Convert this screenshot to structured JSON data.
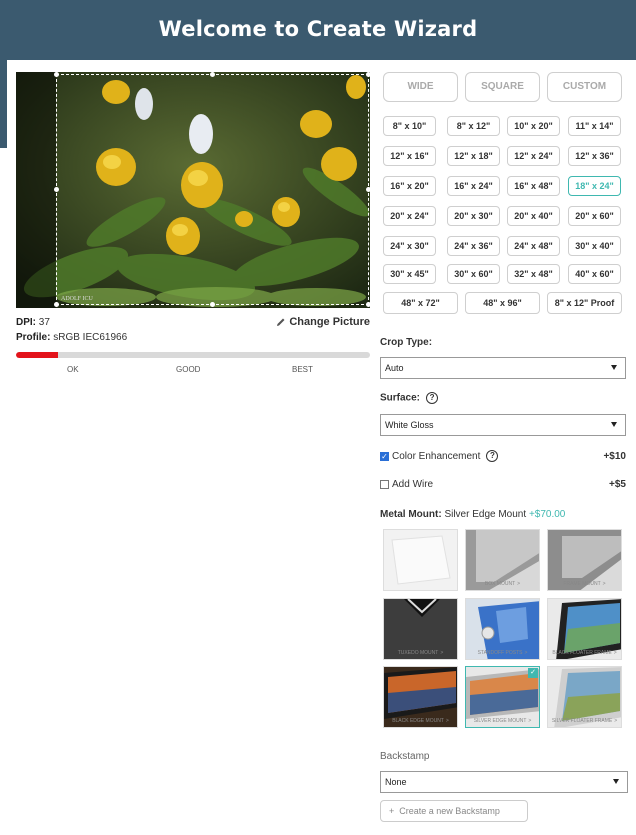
{
  "header": {
    "title": "Welcome to Create Wizard"
  },
  "image_panel": {
    "dpi_label": "DPI:",
    "dpi_value": "37",
    "profile_label": "Profile:",
    "profile_value": "sRGB IEC61966",
    "change_picture": "Change Picture",
    "watermark": "ADOLF ICU",
    "quality": {
      "fraction": 0.12,
      "labels": [
        "OK",
        "GOOD",
        "BEST"
      ]
    }
  },
  "tabs": [
    {
      "label": "WIDE",
      "active": true
    },
    {
      "label": "SQUARE",
      "active": false
    },
    {
      "label": "CUSTOM",
      "active": false
    }
  ],
  "sizes": [
    [
      "8\" x 10\"",
      "8\" x 12\"",
      "10\" x 20\"",
      "11\" x 14\""
    ],
    [
      "12\" x 16\"",
      "12\" x 18\"",
      "12\" x 24\"",
      "12\" x 36\""
    ],
    [
      "16\" x 20\"",
      "16\" x 24\"",
      "16\" x 48\"",
      "18\" x 24\""
    ],
    [
      "20\" x 24\"",
      "20\" x 30\"",
      "20\" x 40\"",
      "20\" x 60\""
    ],
    [
      "24\" x 30\"",
      "24\" x 36\"",
      "24\" x 48\"",
      "30\" x 40\""
    ],
    [
      "30\" x 45\"",
      "30\" x 60\"",
      "32\" x 48\"",
      "40\" x 60\""
    ]
  ],
  "sizes_last_row": [
    "48\" x 72\"",
    "48\" x 96\"",
    "8\" x 12\" Proof"
  ],
  "selected_size": "18\" x 24\"",
  "crop_type": {
    "label": "Crop Type:",
    "value": "Auto"
  },
  "surface": {
    "label": "Surface:",
    "value": "White Gloss",
    "help": "?"
  },
  "options": [
    {
      "label": "Color Enhancement",
      "price": "+$10",
      "checked": true,
      "help": "?"
    },
    {
      "label": "Add Wire",
      "price": "+$5",
      "checked": false
    }
  ],
  "metal_mount": {
    "label": "Metal Mount:",
    "value": "Silver Edge Mount",
    "price": "+$70.00",
    "items": [
      {
        "caption": ""
      },
      {
        "caption": "BOX MOUNT"
      },
      {
        "caption": "FRAME MOUNT"
      },
      {
        "caption": "TUXEDO MOUNT"
      },
      {
        "caption": "STANDOFF POSTS"
      },
      {
        "caption": "BLACK FLOATER FRAME"
      },
      {
        "caption": "BLACK EDGE MOUNT"
      },
      {
        "caption": "SILVER EDGE MOUNT"
      },
      {
        "caption": "SILVER FLOATER FRAME"
      }
    ],
    "selected_index": 7,
    "caption_arrow": ">"
  },
  "backstamp": {
    "label": "Backstamp",
    "value": "None",
    "create_button": "Create a new Backstamp",
    "plus": "+"
  },
  "colors": {
    "header_bg": "#3b5a6f",
    "accent": "#3fb8b0",
    "quality_bad": "#e3131b",
    "checkbox": "#2a6fd6"
  },
  "icons": [
    "pencil-icon",
    "help-icon",
    "caret-down-icon",
    "check-icon",
    "plus-icon"
  ]
}
